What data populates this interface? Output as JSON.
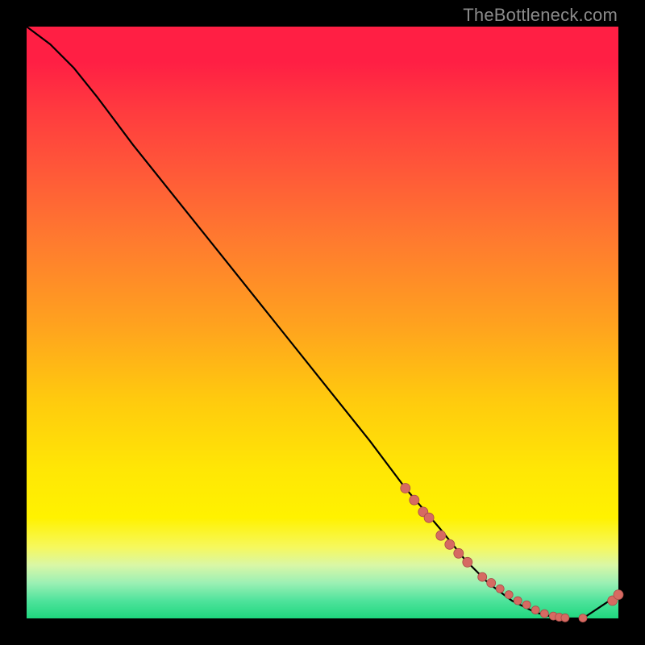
{
  "watermark": "TheBottleneck.com",
  "colors": {
    "page_bg": "#000000",
    "watermark": "#8a8a8a",
    "curve": "#000000",
    "dot_fill": "#d66a62",
    "dot_stroke": "#a84c47",
    "gradient_stops": [
      "#ff1f44",
      "#ff3a3f",
      "#ff5a38",
      "#ff7a2f",
      "#ffa11f",
      "#ffca0e",
      "#ffe705",
      "#fff200",
      "#f6f85e",
      "#d9f7a6",
      "#9cf0b4",
      "#4fe39c",
      "#1fd77e"
    ]
  },
  "chart_data": {
    "type": "line",
    "title": "",
    "xlabel": "",
    "ylabel": "",
    "xlim": [
      0,
      100
    ],
    "ylim": [
      0,
      100
    ],
    "grid": false,
    "legend": false,
    "series": [
      {
        "name": "bottleneck-curve",
        "x": [
          0,
          4,
          8,
          12,
          18,
          26,
          34,
          42,
          50,
          58,
          64,
          70,
          74,
          78,
          82,
          86,
          90,
          94,
          97,
          100
        ],
        "y": [
          100,
          97,
          93,
          88,
          80,
          70,
          60,
          50,
          40,
          30,
          22,
          15,
          10,
          6,
          3,
          1,
          0,
          0,
          2,
          4
        ]
      }
    ],
    "scatter_points": {
      "name": "highlighted-points",
      "x": [
        64,
        65.5,
        67,
        68,
        70,
        71.5,
        73,
        74.5,
        77,
        78.5,
        80,
        81.5,
        83,
        84.5,
        86,
        87.5,
        89,
        90,
        91,
        94,
        99,
        100
      ],
      "y": [
        22,
        20,
        18,
        17,
        14,
        12.5,
        11,
        9.5,
        7,
        6,
        5,
        4,
        3,
        2.3,
        1.4,
        0.8,
        0.4,
        0.2,
        0.1,
        0.05,
        3,
        4
      ],
      "r": [
        6,
        6,
        6,
        6,
        6,
        6,
        6,
        6,
        5.5,
        5.5,
        5,
        5,
        5,
        5,
        5,
        5,
        5,
        5,
        5,
        5,
        6,
        6
      ]
    }
  }
}
